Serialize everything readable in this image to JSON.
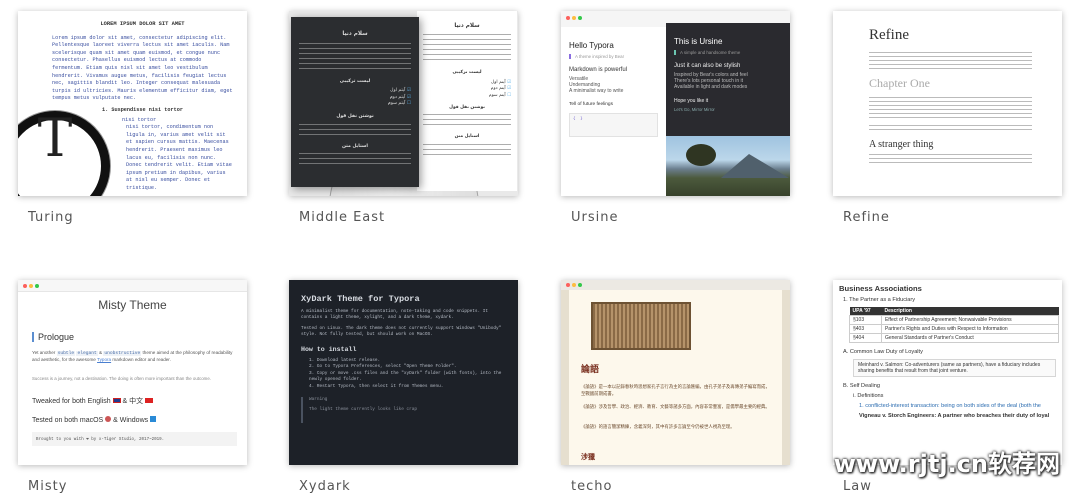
{
  "themes": [
    {
      "name": "Turing"
    },
    {
      "name": "Middle East"
    },
    {
      "name": "Ursine"
    },
    {
      "name": "Refine"
    },
    {
      "name": "Misty"
    },
    {
      "name": "Xydark"
    },
    {
      "name": "techo"
    },
    {
      "name": "Law"
    }
  ],
  "turing": {
    "title": "LOREM IPSUM DOLOR SIT AMET",
    "p1": "Lorem ipsum dolor sit amet, consectetur adipiscing elit. Pellentesque laoreet viverra lectus sit amet iaculis. Nam scelerisque quam sit amet quam euismod, et congue nunc consectetur. Phasellus euismod lectus at commodo fermentum. Etiam quis nisl sit amet leo vestibulum hendrerit. Vivamus augue metus, facilisis feugiat lectus nec, sagittis blandit leo. Integer consequat malesuada turpis id ultricies. Mauris elementum efficitur diam, eget tempus metus vulputate nec.",
    "h": "1. Suspendisse nisi tortor",
    "p2": "nisi tortor",
    "p3": "nisi tortor, condimentum non ligula in, varius amet velit sit et sapien cursus mattis. Maecenas hendrerit. Praesent maximus leo lacus eu, facilisis non nunc. Donec tendrerit velit. Etiam vitae ipsum pretium in dapibus, varius at nisl eu semper. Donec et tristique.",
    "logo": "T"
  },
  "middle_east": {
    "title": "سلام دنیا",
    "sub1": "لیست ترکیبی",
    "sub2": "نوشتن نقل قول",
    "sub3": "استایل متن",
    "items": [
      "آیتم اول",
      "آیتم دوم",
      "آیتم سوم"
    ]
  },
  "ursine": {
    "left_title": "Hello Typora",
    "left_quote": "A theme inspired by Bear",
    "left_h2": "Markdown is powerful",
    "left_items": [
      "Versatile",
      "Undemanding",
      "A minimalist way to write"
    ],
    "left_h3": "Tell of future feelings",
    "right_title": "This is Ursine",
    "right_quote": "A simple and handsome theme",
    "right_h2": "Just it can also be stylish",
    "right_items": [
      "Inspired by Bear's colors and feel",
      "There's lots personal touch in it",
      "Available in light and dark modes"
    ],
    "right_h3": "Hope you like it",
    "right_caption": "Let's Go, Mirror Mirror"
  },
  "refine": {
    "title": "Refine",
    "chapter": "Chapter One",
    "h2": "A stranger thing"
  },
  "misty": {
    "title": "Misty Theme",
    "prologue": "Prologue",
    "text_a": "Yet another",
    "code1": "subtle",
    "code2": "elegant",
    "text_b": "&",
    "code3": "unobstructive",
    "text_c": "theme aimed at the philosophy of readability and aesthetic, for the awesome",
    "link": "Typora",
    "text_d": "markdown editor and reader.",
    "quote": "Success is a journey, not a destination. The doing is often more important than the outcome.",
    "h_english": "Tweaked for both English",
    "h_amp": "&",
    "h_chinese": "中文",
    "h_tested": "Tested on both macOS",
    "h_and": "& Windows",
    "footer": "Brought to you with ❤ by x-Tiger Studio, 2017~2019."
  },
  "xydark": {
    "title": "XyDark Theme for Typora",
    "intro": "A minimalist theme for documentation, note-taking and code snippets. It contains a light theme, xylight, and a dark theme, xydark.",
    "linux": "Tested on Linux. The dark theme does not currently support Windows \"Unibody\" style. Not fully tested, but should work on MacOS.",
    "h2": "How to install",
    "steps": [
      "1. Download latest release.",
      "2. Go to Typora Preferences, select \"Open Theme Folder\".",
      "3. Copy or move .css files and the \"xyDark\" folder (with fonts), into the newly opened folder.",
      "4. Restart Typora, then select it from Themes menu."
    ],
    "warn_h": "Warning",
    "warn": "The light theme currently looks like crap"
  },
  "techo": {
    "heading": "論語",
    "p1": "《論語》是一本以記錄春秋時思想家孔子言行為主的言論匯編，由孔子弟子及再傳弟子編寫而成，至戰國前期成書。",
    "p2": "《論語》涉及哲學、政治、經濟、教育、文藝等諸多方面，內容非常豐富，是儒學最主要的經典。",
    "p3": "《論語》的語言簡潔精練，含義深刻，其中有許多言論至今仍被世人視為至理。",
    "h2": "涉獵"
  },
  "law": {
    "title": "Business Associations",
    "s1": "1. The Partner as a Fiduciary",
    "th": [
      "UPA '97",
      "Description"
    ],
    "rows": [
      [
        "§103",
        "Effect of Partnership Agreement; Nonwaivable Provisions"
      ],
      [
        "§403",
        "Partner's Rights and Duties with Respect to Information"
      ],
      [
        "§404",
        "General Standards of Partner's Conduct"
      ]
    ],
    "a": "A. Common Law Duty of Loyalty",
    "i1": "Meinhard v. Salmon: Co-adventurers (same as partners), have a fiduciary includes sharing benefits that result from that joint venture.",
    "b": "B. Self Dealing",
    "i2": "i. Definitions",
    "i3": "1. conflicted-interest transaction: being on both sides of the deal (both the",
    "i4": "Vigneau v. Storch Engineers: A partner who breaches their duty of loyal"
  },
  "watermark": "www.rjtj.cn软荐网"
}
